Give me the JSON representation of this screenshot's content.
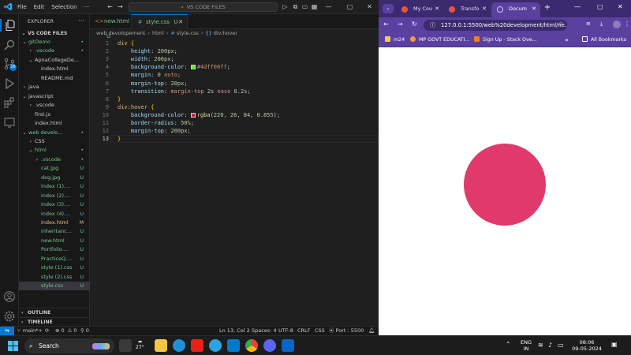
{
  "vscode": {
    "menu": [
      "File",
      "Edit",
      "Selection"
    ],
    "menu_more": "···",
    "command_center": "VS CODE FILES",
    "explorer_title": "EXPLORER",
    "workspace_title": "VS CODE FILES",
    "tree": [
      {
        "name": "gitDemo",
        "status": "•",
        "kind": "folder",
        "depth": 1,
        "open": true,
        "color": "#73c991"
      },
      {
        "name": ".vscode",
        "status": "•",
        "kind": "folder",
        "depth": 2,
        "open": false,
        "color": "#73c991"
      },
      {
        "name": "ApnaCollegeDe...",
        "status": "",
        "kind": "folder",
        "depth": 2,
        "open": true,
        "color": "#cccccc"
      },
      {
        "name": "index.html",
        "status": "",
        "kind": "file",
        "depth": 3,
        "color": "#cccccc"
      },
      {
        "name": "README.md",
        "status": "",
        "kind": "file",
        "depth": 3,
        "color": "#cccccc"
      },
      {
        "name": "java",
        "status": "",
        "kind": "folder",
        "depth": 1,
        "open": false,
        "color": "#cccccc"
      },
      {
        "name": "javascript",
        "status": "",
        "kind": "folder",
        "depth": 1,
        "open": true,
        "color": "#cccccc"
      },
      {
        "name": ".vscode",
        "status": "",
        "kind": "folder",
        "depth": 2,
        "open": false,
        "color": "#cccccc"
      },
      {
        "name": "first.js",
        "status": "",
        "kind": "file",
        "depth": 2,
        "color": "#cccccc"
      },
      {
        "name": "index.html",
        "status": "",
        "kind": "file",
        "depth": 2,
        "color": "#cccccc"
      },
      {
        "name": "web develo...",
        "status": "•",
        "kind": "folder",
        "depth": 1,
        "open": true,
        "color": "#73c991"
      },
      {
        "name": "CSS",
        "status": "",
        "kind": "folder",
        "depth": 2,
        "open": false,
        "color": "#cccccc"
      },
      {
        "name": "html",
        "status": "•",
        "kind": "folder",
        "depth": 2,
        "open": true,
        "color": "#73c991"
      },
      {
        "name": ".vscode",
        "status": "•",
        "kind": "folder",
        "depth": 3,
        "open": false,
        "color": "#73c991"
      },
      {
        "name": "cat.jpg",
        "status": "U",
        "kind": "file",
        "depth": 3,
        "color": "#73c991"
      },
      {
        "name": "dog.jpg",
        "status": "U",
        "kind": "file",
        "depth": 3,
        "color": "#73c991"
      },
      {
        "name": "index (1)....",
        "status": "U",
        "kind": "file",
        "depth": 3,
        "color": "#73c991"
      },
      {
        "name": "index (2)....",
        "status": "U",
        "kind": "file",
        "depth": 3,
        "color": "#73c991"
      },
      {
        "name": "index (3)....",
        "status": "U",
        "kind": "file",
        "depth": 3,
        "color": "#73c991"
      },
      {
        "name": "index (4)....",
        "status": "U",
        "kind": "file",
        "depth": 3,
        "color": "#73c991"
      },
      {
        "name": "index.html",
        "status": "M",
        "kind": "file",
        "depth": 3,
        "color": "#e2c08d"
      },
      {
        "name": "inheritanc...",
        "status": "U",
        "kind": "file",
        "depth": 3,
        "color": "#73c991"
      },
      {
        "name": "new.html",
        "status": "U",
        "kind": "file",
        "depth": 3,
        "color": "#73c991"
      },
      {
        "name": "Portfolio....",
        "status": "U",
        "kind": "file",
        "depth": 3,
        "color": "#73c991"
      },
      {
        "name": "PracticeQ....",
        "status": "U",
        "kind": "file",
        "depth": 3,
        "color": "#73c991"
      },
      {
        "name": "style (1).css",
        "status": "U",
        "kind": "file",
        "depth": 3,
        "color": "#73c991"
      },
      {
        "name": "style (2).css",
        "status": "U",
        "kind": "file",
        "depth": 3,
        "color": "#73c991"
      },
      {
        "name": "style.css",
        "status": "U",
        "kind": "file",
        "depth": 3,
        "color": "#73c991",
        "selected": true
      }
    ],
    "outline_label": "OUTLINE",
    "timeline_label": "TIMELINE",
    "tabs": [
      {
        "label": "new.html",
        "status": "U",
        "icon": "<>",
        "icon_color": "#e37933",
        "active": false
      },
      {
        "label": "style.css",
        "status": "U",
        "icon": "#",
        "icon_color": "#519aba",
        "active": true
      }
    ],
    "breadcrumb": [
      "web devolopement",
      "html",
      "style.css",
      "div:hover"
    ],
    "active_line": 13,
    "code_lines": [
      [
        {
          "t": "div",
          "c": "k-sel"
        },
        {
          "t": " ",
          "c": "k-punc"
        },
        {
          "t": "{",
          "c": "k-brace"
        }
      ],
      [
        {
          "t": "    height",
          "c": "k-prop"
        },
        {
          "t": ": ",
          "c": "k-punc"
        },
        {
          "t": "200px",
          "c": "k-val"
        },
        {
          "t": ";",
          "c": "k-punc"
        }
      ],
      [
        {
          "t": "    width",
          "c": "k-prop"
        },
        {
          "t": ": ",
          "c": "k-punc"
        },
        {
          "t": "200px",
          "c": "k-val"
        },
        {
          "t": ";",
          "c": "k-punc"
        }
      ],
      [
        {
          "t": "    background-color",
          "c": "k-prop"
        },
        {
          "t": ": ",
          "c": "k-punc"
        },
        {
          "t": "",
          "c": "swatch",
          "swatch": "#4dff00"
        },
        {
          "t": "#4dff00ff",
          "c": "k-str"
        },
        {
          "t": ";",
          "c": "k-punc"
        }
      ],
      [
        {
          "t": "    margin",
          "c": "k-prop"
        },
        {
          "t": ": ",
          "c": "k-punc"
        },
        {
          "t": "0 ",
          "c": "k-val"
        },
        {
          "t": "auto",
          "c": "k-str"
        },
        {
          "t": ";",
          "c": "k-punc"
        }
      ],
      [
        {
          "t": "    margin-top",
          "c": "k-prop"
        },
        {
          "t": ": ",
          "c": "k-punc"
        },
        {
          "t": "20px",
          "c": "k-val"
        },
        {
          "t": ";",
          "c": "k-punc"
        }
      ],
      [
        {
          "t": "    transition",
          "c": "k-prop"
        },
        {
          "t": ": ",
          "c": "k-punc"
        },
        {
          "t": "margin-top ",
          "c": "k-str"
        },
        {
          "t": "2s ",
          "c": "k-val"
        },
        {
          "t": "ease ",
          "c": "k-str"
        },
        {
          "t": "0.2s",
          "c": "k-val"
        },
        {
          "t": ";",
          "c": "k-punc"
        }
      ],
      [
        {
          "t": "}",
          "c": "k-brace"
        }
      ],
      [
        {
          "t": "div:hover",
          "c": "k-sel"
        },
        {
          "t": " ",
          "c": "k-punc"
        },
        {
          "t": "{",
          "c": "k-brace"
        }
      ],
      [
        {
          "t": "    background-color",
          "c": "k-prop"
        },
        {
          "t": ": ",
          "c": "k-punc"
        },
        {
          "t": "",
          "c": "swatch",
          "swatch": "#dc1a54"
        },
        {
          "t": "rgba",
          "c": "k-fn"
        },
        {
          "t": "(",
          "c": "k-punc"
        },
        {
          "t": "220, 26, 84, 0.855",
          "c": "k-val"
        },
        {
          "t": ");",
          "c": "k-punc"
        }
      ],
      [
        {
          "t": "    border-radius",
          "c": "k-prop"
        },
        {
          "t": ": ",
          "c": "k-punc"
        },
        {
          "t": "50%",
          "c": "k-val"
        },
        {
          "t": ";",
          "c": "k-punc"
        }
      ],
      [
        {
          "t": "    margin-top",
          "c": "k-prop"
        },
        {
          "t": ": ",
          "c": "k-punc"
        },
        {
          "t": "200px",
          "c": "k-val"
        },
        {
          "t": ";",
          "c": "k-punc"
        }
      ],
      [
        {
          "t": "}",
          "c": "k-brace"
        }
      ]
    ],
    "status": {
      "branch": "main*+",
      "errors": "0",
      "warnings": "0",
      "ports": "0",
      "cursor": "Ln 13, Col 2",
      "spaces": "Spaces: 4",
      "encoding": "UTF-8",
      "eol": "CRLF",
      "language": "CSS",
      "port": "Port : 5500"
    }
  },
  "chrome": {
    "tabs": [
      {
        "label": "My Cou",
        "favicon_color": "#e8553b",
        "active": false
      },
      {
        "label": "Transfo",
        "favicon_color": "#e8553b",
        "active": false
      },
      {
        "label": "Docum",
        "favicon_color": "#cfc6ff",
        "active": true
      }
    ],
    "new_tab": "+",
    "url": "127.0.0.1:5500/web%20development/html/ne...",
    "bookmarks": [
      {
        "label": "m24",
        "icon_color": "#f2c94c"
      },
      {
        "label": "MP GOVT EDUCATI...",
        "icon_color": "#f2994a"
      },
      {
        "label": "Sign Up - Stack Ove...",
        "icon_color": "#f48024"
      }
    ],
    "bookmarks_more": "»",
    "all_bookmarks": "All Bookmarks",
    "circle_color": "#e03a6c"
  },
  "taskbar": {
    "search_placeholder": "Search",
    "weather_temp": "27°",
    "apps": [
      {
        "name": "task-view-app",
        "color": "#3a3a3a"
      },
      {
        "name": "file-explorer-app",
        "color": "#f4c542"
      },
      {
        "name": "edge-app",
        "color": "#1e90d6"
      },
      {
        "name": "youtube-app",
        "color": "#e62117"
      },
      {
        "name": "telegram-app",
        "color": "#2aa4e0"
      },
      {
        "name": "vscode-app",
        "color": "#007acc"
      },
      {
        "name": "chrome-app",
        "color": "#34a853"
      },
      {
        "name": "discord-app",
        "color": "#5865f2"
      },
      {
        "name": "linkedin-app",
        "color": "#0a66c2"
      }
    ],
    "lang": "ENG",
    "region": "IN",
    "time": "08:06",
    "date": "09-05-2024"
  }
}
